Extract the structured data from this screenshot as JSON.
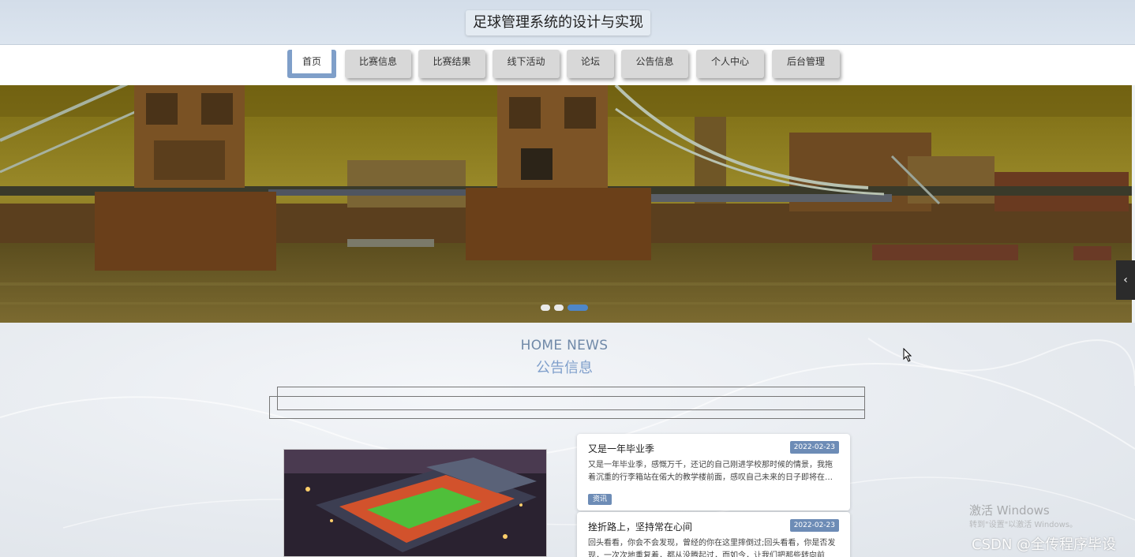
{
  "header": {
    "title": "足球管理系统的设计与实现"
  },
  "nav": {
    "items": [
      {
        "label": "首页",
        "active": true
      },
      {
        "label": "比赛信息"
      },
      {
        "label": "比赛结果"
      },
      {
        "label": "线下活动"
      },
      {
        "label": "论坛"
      },
      {
        "label": "公告信息"
      },
      {
        "label": "个人中心"
      },
      {
        "label": "后台管理"
      }
    ]
  },
  "banner": {
    "slide_count": 3,
    "active_slide": 3,
    "scroll_icon": "chevron-left-icon"
  },
  "section": {
    "en_title": "HOME NEWS",
    "cn_title": "公告信息"
  },
  "news": [
    {
      "title": "又是一年毕业季",
      "date": "2022-02-23",
      "summary_line1": "又是一年毕业季，感慨万千，还记的自己刚进学校那时候的情景，我拖",
      "summary_line2": "着沉重的行李箱站在偌大的教学楼前面，感叹自己未来的日子即将在…",
      "tag": "资讯"
    },
    {
      "title": "挫折路上，坚持常在心间",
      "date": "2022-02-23",
      "summary_line1": "回头看看，你会不会发现，曾经的你在这里摔倒过;回头看看，你是否发",
      "summary_line2": "现，一次次地重复着，都从没腾起过，而如今，让我们把那些转向前"
    }
  ],
  "watermarks": {
    "activate_line1": "激活 Windows",
    "activate_line2": "转到\"设置\"以激活 Windows。",
    "csdn": "CSDN @全传程序毕设"
  },
  "colors": {
    "accent": "#7f9fc9",
    "badge": "#6d8cb6",
    "title_blue": "#7f9fcb"
  }
}
